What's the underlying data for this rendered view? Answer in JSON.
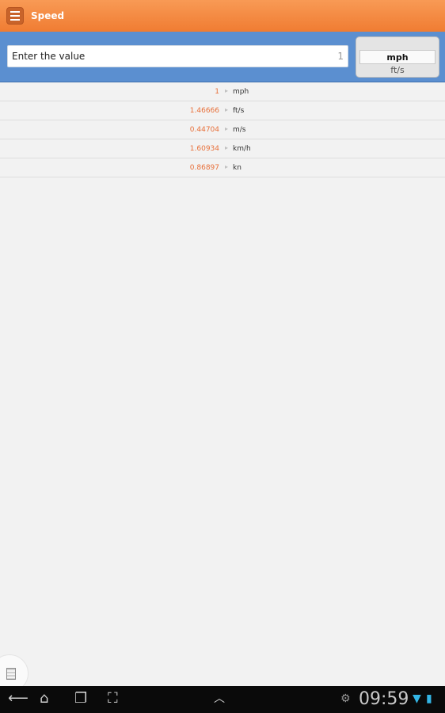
{
  "app": {
    "title": "Speed"
  },
  "input": {
    "placeholder": "Enter the value",
    "value": "1"
  },
  "unit_picker": {
    "selected": "mph",
    "next": "ft/s"
  },
  "results": [
    {
      "value": "1",
      "unit": "mph"
    },
    {
      "value": "1.46666",
      "unit": "ft/s"
    },
    {
      "value": "0.44704",
      "unit": "m/s"
    },
    {
      "value": "1.60934",
      "unit": "km/h"
    },
    {
      "value": "0.86897",
      "unit": "kn"
    }
  ],
  "system_bar": {
    "time": "09:59"
  },
  "colors": {
    "titlebar": "#f07c32",
    "inputbar": "#5b8fd0",
    "result_value": "#e8703a"
  }
}
